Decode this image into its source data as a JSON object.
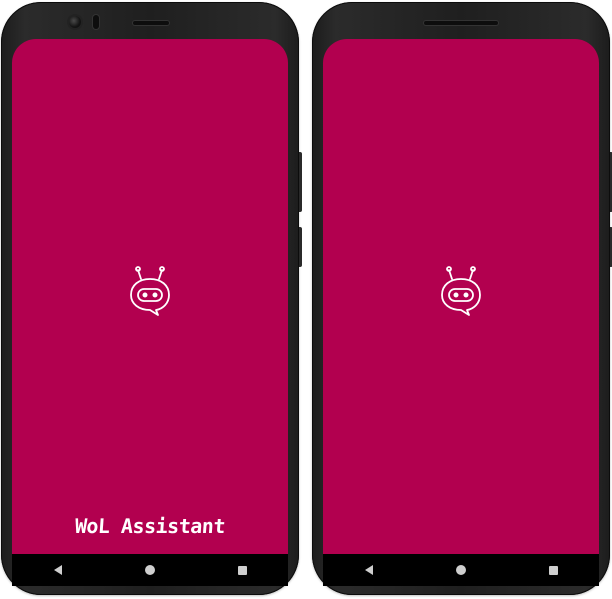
{
  "phones": [
    {
      "screen": {
        "background_color": "#b2004f",
        "icon": "chatbot-icon",
        "brand_name": "WoL Assistant"
      },
      "navbar": {
        "back_icon": "back-icon",
        "home_icon": "home-icon",
        "recents_icon": "recents-icon"
      }
    },
    {
      "screen": {
        "background_color": "#b2004f",
        "icon": "chatbot-icon"
      },
      "navbar": {
        "back_icon": "back-icon",
        "home_icon": "home-icon",
        "recents_icon": "recents-icon"
      }
    }
  ]
}
